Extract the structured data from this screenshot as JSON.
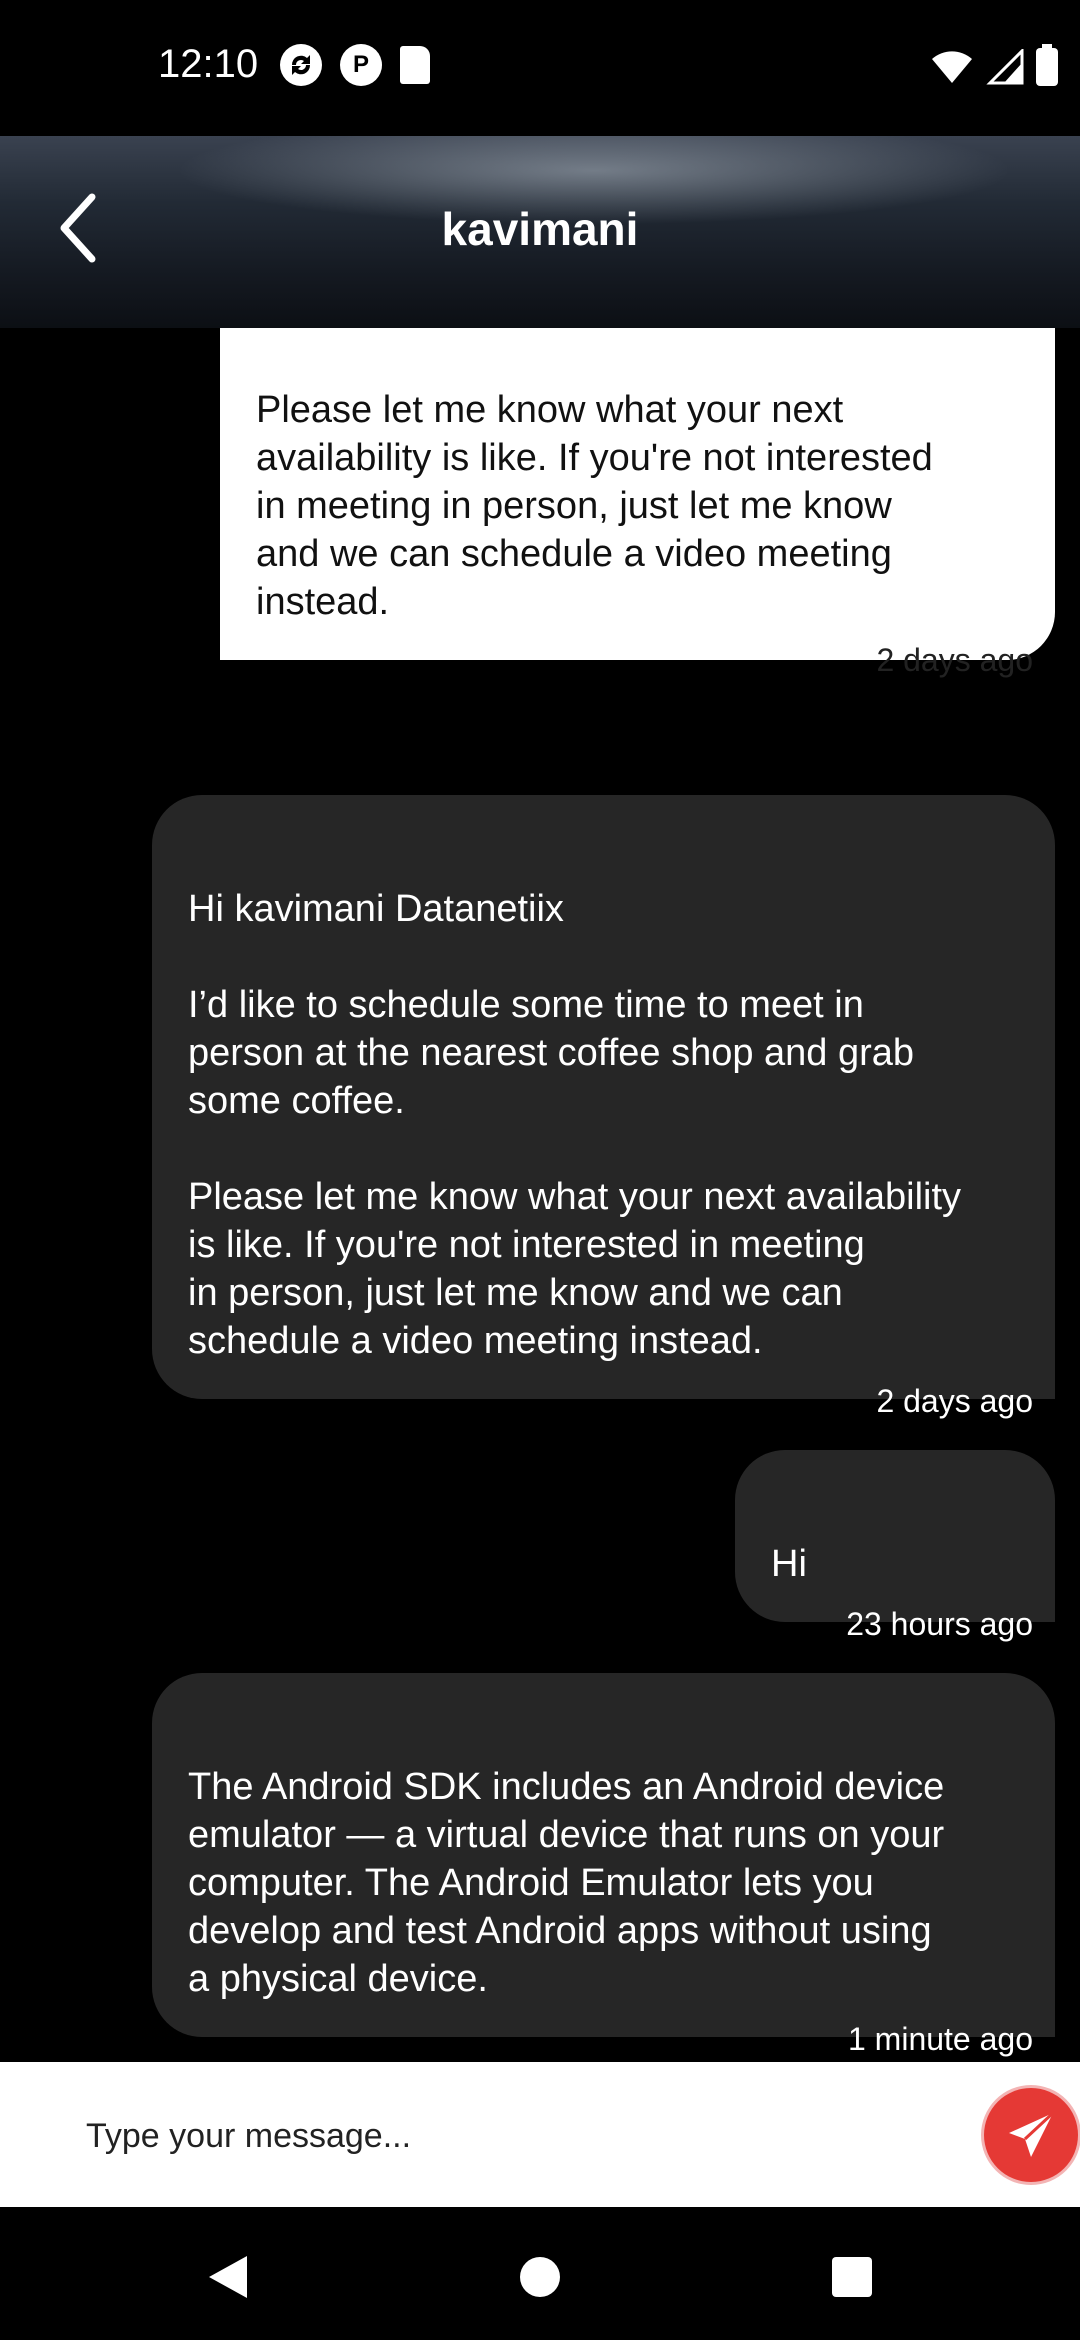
{
  "status_bar": {
    "time": "12:10",
    "left_icons": [
      "sync-icon",
      "p-badge-icon",
      "sd-card-icon"
    ],
    "right_icons": [
      "wifi-icon",
      "signal-icon",
      "battery-icon"
    ]
  },
  "header": {
    "title": "kavimani",
    "back_icon": "chevron-left-icon"
  },
  "messages": [
    {
      "text": "Please let me know what your next\navailability is like. If you're not interested\nin meeting in person, just let me know\nand we can schedule a video meeting\ninstead.",
      "time": "2 days ago",
      "style": "white"
    },
    {
      "text": "Hi kavimani Datanetiix\n\nI’d like to schedule some time to meet in\nperson at the nearest coffee shop and grab\nsome coffee.\n\nPlease let me know what your next availability\nis like. If you're not interested in meeting\nin person, just let me know and we can\nschedule a video meeting instead.",
      "time": "2 days ago",
      "style": "dark"
    },
    {
      "text": "Hi",
      "time": "23 hours ago",
      "style": "dark"
    },
    {
      "text": "The Android SDK includes an Android device\nemulator — a virtual device that runs on your\ncomputer. The Android Emulator lets you\ndevelop and test Android apps without using\na physical device.",
      "time": "1 minute ago",
      "style": "dark"
    }
  ],
  "composer": {
    "placeholder": "Type your message...",
    "send_icon": "paper-plane-icon"
  },
  "nav_bar": {
    "icons": [
      "nav-back-icon",
      "nav-home-icon",
      "nav-recents-icon"
    ]
  },
  "colors": {
    "background": "#000000",
    "bubble_dark": "#262626",
    "bubble_white": "#ffffff",
    "send_button": "#e53935"
  }
}
